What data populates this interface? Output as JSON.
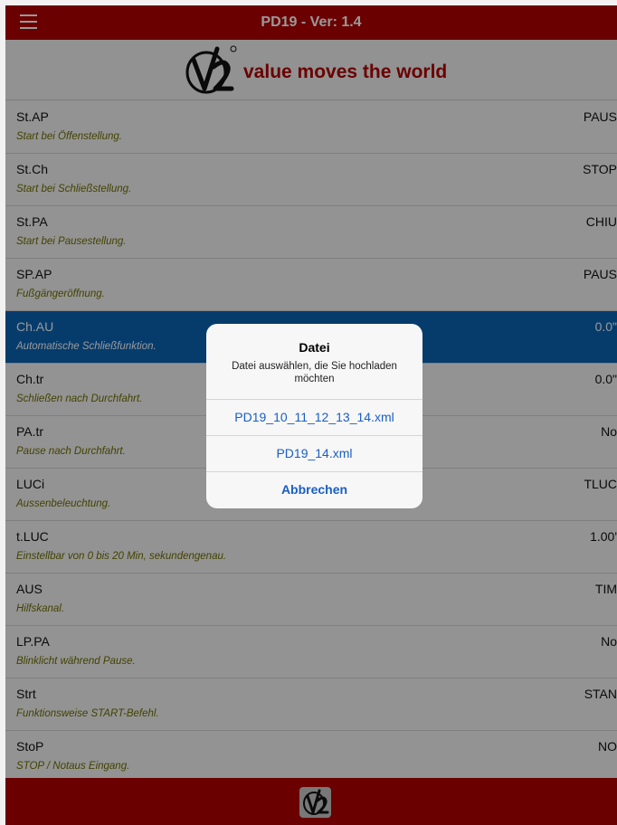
{
  "header": {
    "title": "PD19 - Ver: 1.4",
    "menu_icon": "hamburger-menu-icon"
  },
  "brand": {
    "logo_text": "V2",
    "tagline": "value moves the world"
  },
  "rows": [
    {
      "name": "St.AP",
      "desc": "Start bei Öffenstellung.",
      "value": "PAUS"
    },
    {
      "name": "St.Ch",
      "desc": "Start bei Schließstellung.",
      "value": "STOP"
    },
    {
      "name": "St.PA",
      "desc": "Start bei Pausestellung.",
      "value": "CHIU"
    },
    {
      "name": "SP.AP",
      "desc": "Fußgängeröffnung.",
      "value": "PAUS"
    },
    {
      "name": "Ch.AU",
      "desc": "Automatische Schließfunktion.",
      "value": "0.0\""
    },
    {
      "name": "Ch.tr",
      "desc": "Schließen nach Durchfahrt.",
      "value": "0.0\""
    },
    {
      "name": "PA.tr",
      "desc": "Pause nach Durchfahrt.",
      "value": "No"
    },
    {
      "name": "LUCi",
      "desc": "Aussenbeleuchtung.",
      "value": "TLUC"
    },
    {
      "name": "t.LUC",
      "desc": "Einstellbar von 0 bis 20 Min, sekundengenau.",
      "value": "1.00'"
    },
    {
      "name": "AUS",
      "desc": "Hilfskanal.",
      "value": "TIM"
    },
    {
      "name": "LP.PA",
      "desc": "Blinklicht während Pause.",
      "value": "No"
    },
    {
      "name": "Strt",
      "desc": "Funktionsweise START-Befehl.",
      "value": "STAN"
    },
    {
      "name": "StoP",
      "desc": "STOP / Notaus Eingang.",
      "value": "NO"
    }
  ],
  "dialog": {
    "title": "Datei",
    "message": "Datei auswählen, die Sie hochladen möchten",
    "options": [
      "PD19_10_11_12_13_14.xml",
      "PD19_14.xml"
    ],
    "cancel_label": "Abbrechen"
  },
  "colors": {
    "header_red": "#b30000",
    "selection_blue": "#0a64b4",
    "dialog_button_blue": "#1a5ec4"
  }
}
